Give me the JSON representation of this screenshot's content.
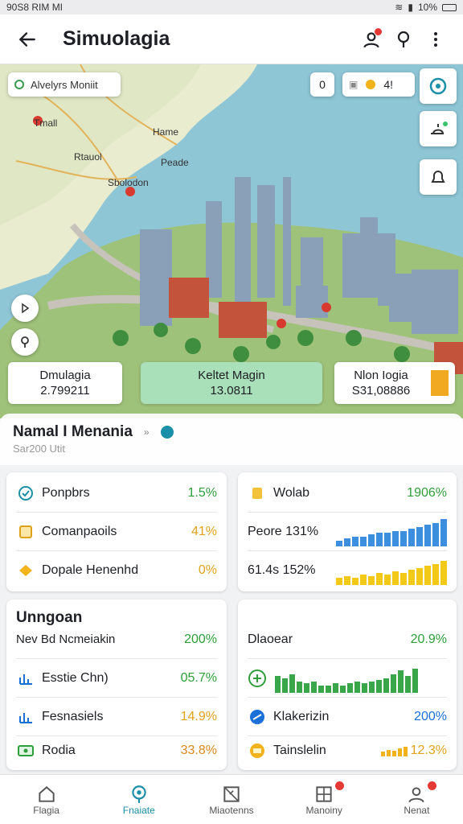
{
  "status_bar": {
    "left": "90S8 RIM MI",
    "right": "10%"
  },
  "app_bar": {
    "title": "Simuolagia"
  },
  "map": {
    "search_chip": "Alvelyrs Moniit",
    "zoom_chip": "0",
    "coins_value": "4!",
    "labels": [
      "Tmall",
      "Hame",
      "Rtauol",
      "Peade",
      "Sbolodon"
    ]
  },
  "stat_cards": [
    {
      "title": "Dmulagia",
      "value": "2.799211",
      "bg": "#ffffff"
    },
    {
      "title": "Keltet Magin",
      "value": "13.0811",
      "bg": "#a9dfb9"
    },
    {
      "title": "Nlon Iogia",
      "value": "S31,08886",
      "bg": "#ffffff"
    }
  ],
  "sheet": {
    "title": "Namal I Menania",
    "subtitle": "Sar200 Utit",
    "icon_text": "»"
  },
  "card1": {
    "rows": [
      {
        "icon": "check-circle",
        "label": "Ponpbrs",
        "value": "1.5%",
        "color": "#2e9e3a"
      },
      {
        "icon": "document",
        "label": "Comanpaoils",
        "value": "41%",
        "color": "#e0a21a"
      },
      {
        "icon": "coin",
        "label": "Dopale Henenhd",
        "value": "0%",
        "color": "#e0a21a"
      }
    ]
  },
  "card2": {
    "header_label": "Wolab",
    "header_value": "1906%",
    "rows": [
      {
        "label": "Peore 131%",
        "bars": [
          3,
          4,
          5,
          5,
          6,
          7,
          7,
          8,
          8,
          9,
          10,
          11,
          12,
          14
        ],
        "bar_color": "#3c8fde"
      },
      {
        "label": "61.4s 152%",
        "bars": [
          4,
          5,
          4,
          6,
          5,
          7,
          6,
          8,
          7,
          9,
          10,
          11,
          12,
          14
        ],
        "bar_color": "#f2c916"
      }
    ]
  },
  "card3": {
    "title": "Unngoan",
    "subtitle": "Nev Bd Ncmeiakin",
    "subtitle_value": "200%",
    "rows": [
      {
        "icon": "bar-chart",
        "label": "Esstie Chn)",
        "value": "05.7%",
        "color": "#2e9e3a"
      },
      {
        "icon": "bar-chart",
        "label": "Fesnasiels",
        "value": "14.9%",
        "color": "#e0a21a"
      },
      {
        "icon": "money",
        "label": "Rodia",
        "value": "33.8%",
        "color": "#d98a1c"
      }
    ]
  },
  "card4": {
    "title": "Dlaoear",
    "title_value": "20.9%",
    "chart_bars": [
      9,
      8,
      10,
      6,
      5,
      6,
      4,
      4,
      5,
      4,
      5,
      6,
      5,
      6,
      7,
      8,
      10,
      12,
      9,
      13
    ],
    "rows": [
      {
        "icon": "gear",
        "label": "Klakerizin",
        "value": "200%",
        "color": "#1b6fd8"
      },
      {
        "icon": "money",
        "label": "Tainslelin",
        "value": "12.3%",
        "color": "#e0a21a"
      }
    ]
  },
  "nav": [
    {
      "label": "Flagia",
      "icon": "home",
      "active": false
    },
    {
      "label": "Fnaiate",
      "icon": "location",
      "active": true
    },
    {
      "label": "Miaotenns",
      "icon": "map",
      "active": false
    },
    {
      "label": "Manoiny",
      "icon": "grid",
      "active": false
    },
    {
      "label": "Nenat",
      "icon": "user",
      "active": false
    }
  ]
}
